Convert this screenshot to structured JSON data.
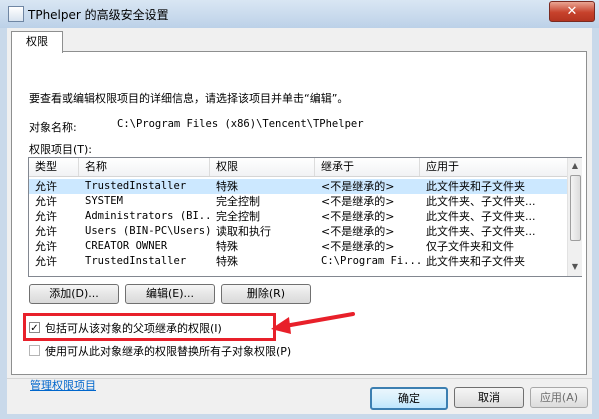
{
  "window": {
    "title": "TPhelper 的高级安全设置",
    "close_label": "✕"
  },
  "tabs": [
    {
      "label": "权限",
      "selected": true
    }
  ],
  "instruction": "要查看或编辑权限项目的详细信息，请选择该项目并单击“编辑”。",
  "object": {
    "label": "对象名称:",
    "value": "C:\\Program Files (x86)\\Tencent\\TPhelper"
  },
  "permissions": {
    "label": "权限项目(T):",
    "columns": [
      "类型",
      "名称",
      "权限",
      "继承于",
      "应用于"
    ],
    "rows": [
      {
        "type": "允许",
        "name": "TrustedInstaller",
        "perm": "特殊",
        "inherited": "<不是继承的>",
        "applies": "此文件夹和子文件夹"
      },
      {
        "type": "允许",
        "name": "SYSTEM",
        "perm": "完全控制",
        "inherited": "<不是继承的>",
        "applies": "此文件夹、子文件夹..."
      },
      {
        "type": "允许",
        "name": "Administrators (BI...",
        "perm": "完全控制",
        "inherited": "<不是继承的>",
        "applies": "此文件夹、子文件夹..."
      },
      {
        "type": "允许",
        "name": "Users (BIN-PC\\Users)",
        "perm": "读取和执行",
        "inherited": "<不是继承的>",
        "applies": "此文件夹、子文件夹..."
      },
      {
        "type": "允许",
        "name": "CREATOR OWNER",
        "perm": "特殊",
        "inherited": "<不是继承的>",
        "applies": "仅子文件夹和文件"
      },
      {
        "type": "允许",
        "name": "TrustedInstaller",
        "perm": "特殊",
        "inherited": "C:\\Program Fi...",
        "applies": "此文件夹和子文件夹"
      }
    ]
  },
  "buttons": {
    "add": "添加(D)...",
    "edit": "编辑(E)...",
    "remove": "删除(R)"
  },
  "checkboxes": {
    "inherit": {
      "label": "包括可从该对象的父项继承的权限(I)",
      "checked": true,
      "mark": "✓"
    },
    "replace": {
      "label": "使用可从此对象继承的权限替换所有子对象权限(P)",
      "checked": false
    }
  },
  "link": "管理权限项目",
  "footer": {
    "ok": "确定",
    "cancel": "取消",
    "apply": "应用(A)"
  },
  "colors": {
    "highlight": "#e8202a",
    "selected_row": "#cce8ff",
    "link": "#0066cc"
  },
  "icons": {
    "scroll_up": "▲",
    "scroll_down": "▼"
  }
}
